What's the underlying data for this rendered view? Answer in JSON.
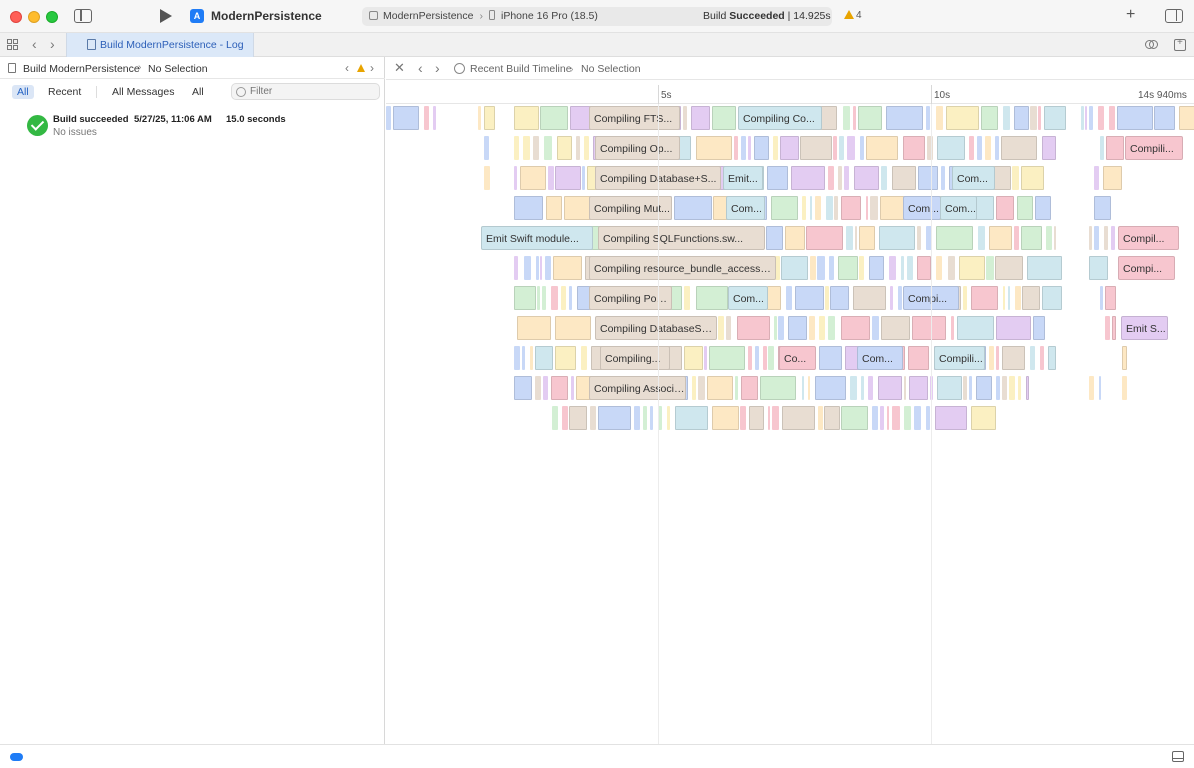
{
  "titlebar": {
    "project_name": "ModernPersistence",
    "scheme_target": "ModernPersistence",
    "scheme_device": "iPhone 16 Pro (18.5)",
    "build_status_prefix": "Build ",
    "build_status_bold": "Succeeded",
    "build_status_suffix": " | 14.925s",
    "warning_count": "4"
  },
  "tabbar": {
    "active_tab": "Build ModernPersistence - Log"
  },
  "left": {
    "crumb_root": "Build ModernPersistence",
    "crumb_sel": "No Selection",
    "filters": [
      "All",
      "Recent",
      "All Messages",
      "All"
    ],
    "filter_placeholder": "Filter",
    "entry": {
      "title": "Build succeeded",
      "date": "5/27/25, 11:06 AM",
      "duration": "15.0 seconds",
      "subtitle": "No issues"
    }
  },
  "right": {
    "crumb_root": "Recent Build Timeline",
    "crumb_sel": "No Selection",
    "ruler": [
      {
        "label": "5s",
        "t": 5
      },
      {
        "label": "10s",
        "t": 10
      },
      {
        "label": "14s 940ms",
        "t": 14.94
      }
    ],
    "timeline": {
      "t_start": 0.0,
      "t_end": 14.94,
      "tasks": [
        {
          "label": "Compiling FTS...",
          "row": 0,
          "t0": 3.72,
          "t1": 5.39,
          "color": "#e8ddd2"
        },
        {
          "label": "Compiling Co...",
          "row": 0,
          "t0": 6.46,
          "t1": 8.01,
          "color": "#cfe7ee"
        },
        {
          "label": "Compiling Op...",
          "row": 1,
          "t0": 3.83,
          "t1": 5.39,
          "color": "#e8ddd2"
        },
        {
          "label": "Compili...",
          "row": 1,
          "t0": 13.57,
          "t1": 14.63,
          "color": "#f7c6cf"
        },
        {
          "label": "Compiling Database+S...",
          "row": 2,
          "t0": 3.83,
          "t1": 6.15,
          "color": "#e8ddd2"
        },
        {
          "label": "Emit...",
          "row": 2,
          "t0": 6.18,
          "t1": 6.92,
          "color": "#cfe7ee"
        },
        {
          "label": "Com...",
          "row": 2,
          "t0": 10.38,
          "t1": 11.18,
          "color": "#cfe7ee"
        },
        {
          "label": "Compiling Mut...",
          "row": 3,
          "t0": 3.72,
          "t1": 5.25,
          "color": "#e8ddd2"
        },
        {
          "label": "Com...",
          "row": 3,
          "t0": 6.24,
          "t1": 6.95,
          "color": "#cfe7ee"
        },
        {
          "label": "Com...",
          "row": 3,
          "t0": 9.48,
          "t1": 10.18,
          "color": "#c8d8f7"
        },
        {
          "label": "Com...",
          "row": 3,
          "t0": 10.16,
          "t1": 10.84,
          "color": "#cfe7ee"
        },
        {
          "label": "Emit Swift module...",
          "row": 4,
          "t0": 1.75,
          "t1": 3.8,
          "color": "#cfe7ee"
        },
        {
          "label": "Compiling SQLFunctions.sw...",
          "row": 4,
          "t0": 3.9,
          "t1": 6.95,
          "color": "#e8ddd2"
        },
        {
          "label": "Compil...",
          "row": 4,
          "t0": 13.43,
          "t1": 14.56,
          "color": "#f7c6cf"
        },
        {
          "label": "Compiling resource_bundle_accessor....",
          "row": 5,
          "t0": 3.72,
          "t1": 7.15,
          "color": "#e8ddd2"
        },
        {
          "label": "Compi...",
          "row": 5,
          "t0": 13.43,
          "t1": 14.49,
          "color": "#f7c6cf"
        },
        {
          "label": "Compiling Pool....",
          "row": 6,
          "t0": 3.72,
          "t1": 5.25,
          "color": "#e8ddd2"
        },
        {
          "label": "Com...",
          "row": 6,
          "t0": 6.28,
          "t1": 7.02,
          "color": "#cfe7ee"
        },
        {
          "label": "Compi...",
          "row": 6,
          "t0": 9.48,
          "t1": 10.51,
          "color": "#c8d8f7"
        },
        {
          "label": "Compiling DatabaseSnaps...",
          "row": 7,
          "t0": 3.83,
          "t1": 6.07,
          "color": "#e8ddd2"
        },
        {
          "label": "Emit S...",
          "row": 7,
          "t0": 13.49,
          "t1": 14.36,
          "color": "#e3ccf2"
        },
        {
          "label": "Compiling...",
          "row": 8,
          "t0": 3.93,
          "t1": 5.21,
          "color": "#e8ddd2"
        },
        {
          "label": "Co...",
          "row": 8,
          "t0": 7.21,
          "t1": 7.9,
          "color": "#f7c6cf"
        },
        {
          "label": "Com...",
          "row": 8,
          "t0": 8.65,
          "t1": 9.49,
          "color": "#c8d8f7"
        },
        {
          "label": "Compili...",
          "row": 8,
          "t0": 10.06,
          "t1": 11.0,
          "color": "#cfe7ee"
        },
        {
          "label": "Compiling Association...",
          "row": 9,
          "t0": 3.72,
          "t1": 5.51,
          "color": "#e8ddd2"
        }
      ]
    }
  }
}
